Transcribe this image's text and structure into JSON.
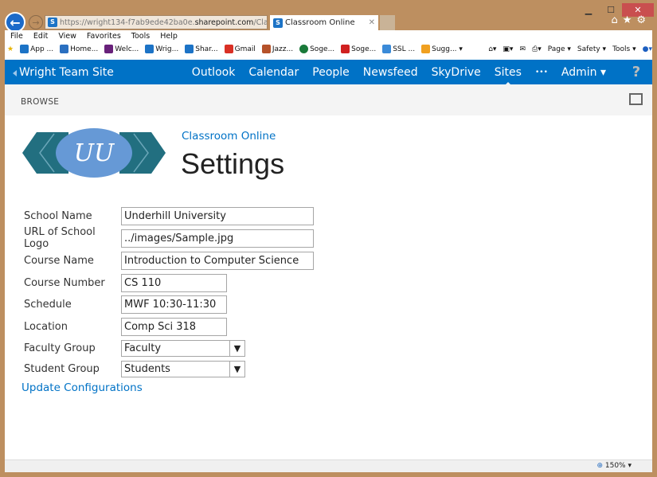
{
  "browser": {
    "address": {
      "prefix": "https://wright134-f7ab9ede42ba0e.",
      "domain": "sharepoint.com",
      "suffix": "/Classrc"
    },
    "tab_title": "Classroom Online",
    "menu": [
      "File",
      "Edit",
      "View",
      "Favorites",
      "Tools",
      "Help"
    ],
    "favorites": [
      "App ...",
      "Home...",
      "Welc...",
      "Wrig...",
      "Shar...",
      "Gmail",
      "Jazz...",
      "Soge...",
      "Soge...",
      "SSL ...",
      "Sugg..."
    ],
    "commands": [
      "Page ▾",
      "Safety ▾",
      "Tools ▾"
    ],
    "zoom": "150%"
  },
  "suite": {
    "site_title": "Wright Team Site",
    "nav": [
      "Outlook",
      "Calendar",
      "People",
      "Newsfeed",
      "SkyDrive",
      "Sites",
      "•••",
      "Admin ▾"
    ],
    "active": "Sites",
    "help": "?"
  },
  "ribbon": {
    "browse": "BROWSE"
  },
  "page": {
    "breadcrumb": "Classroom Online",
    "title": "Settings",
    "logo_text": "UU"
  },
  "form": {
    "fields": [
      {
        "label": "School Name",
        "value": "Underhill University"
      },
      {
        "label": "URL of School Logo",
        "value": "../images/Sample.jpg"
      },
      {
        "label": "Course Name",
        "value": "Introduction to Computer Science"
      },
      {
        "label": "Course Number",
        "value": "CS 110"
      },
      {
        "label": "Schedule",
        "value": "MWF 10:30-11:30"
      },
      {
        "label": "Location",
        "value": "Comp Sci 318"
      }
    ],
    "selects": [
      {
        "label": "Faculty Group",
        "value": "Faculty"
      },
      {
        "label": "Student Group",
        "value": "Students"
      }
    ],
    "update_link": "Update Configurations"
  },
  "colors": {
    "brand": "#0072c6",
    "frame": "#bd8f60"
  }
}
